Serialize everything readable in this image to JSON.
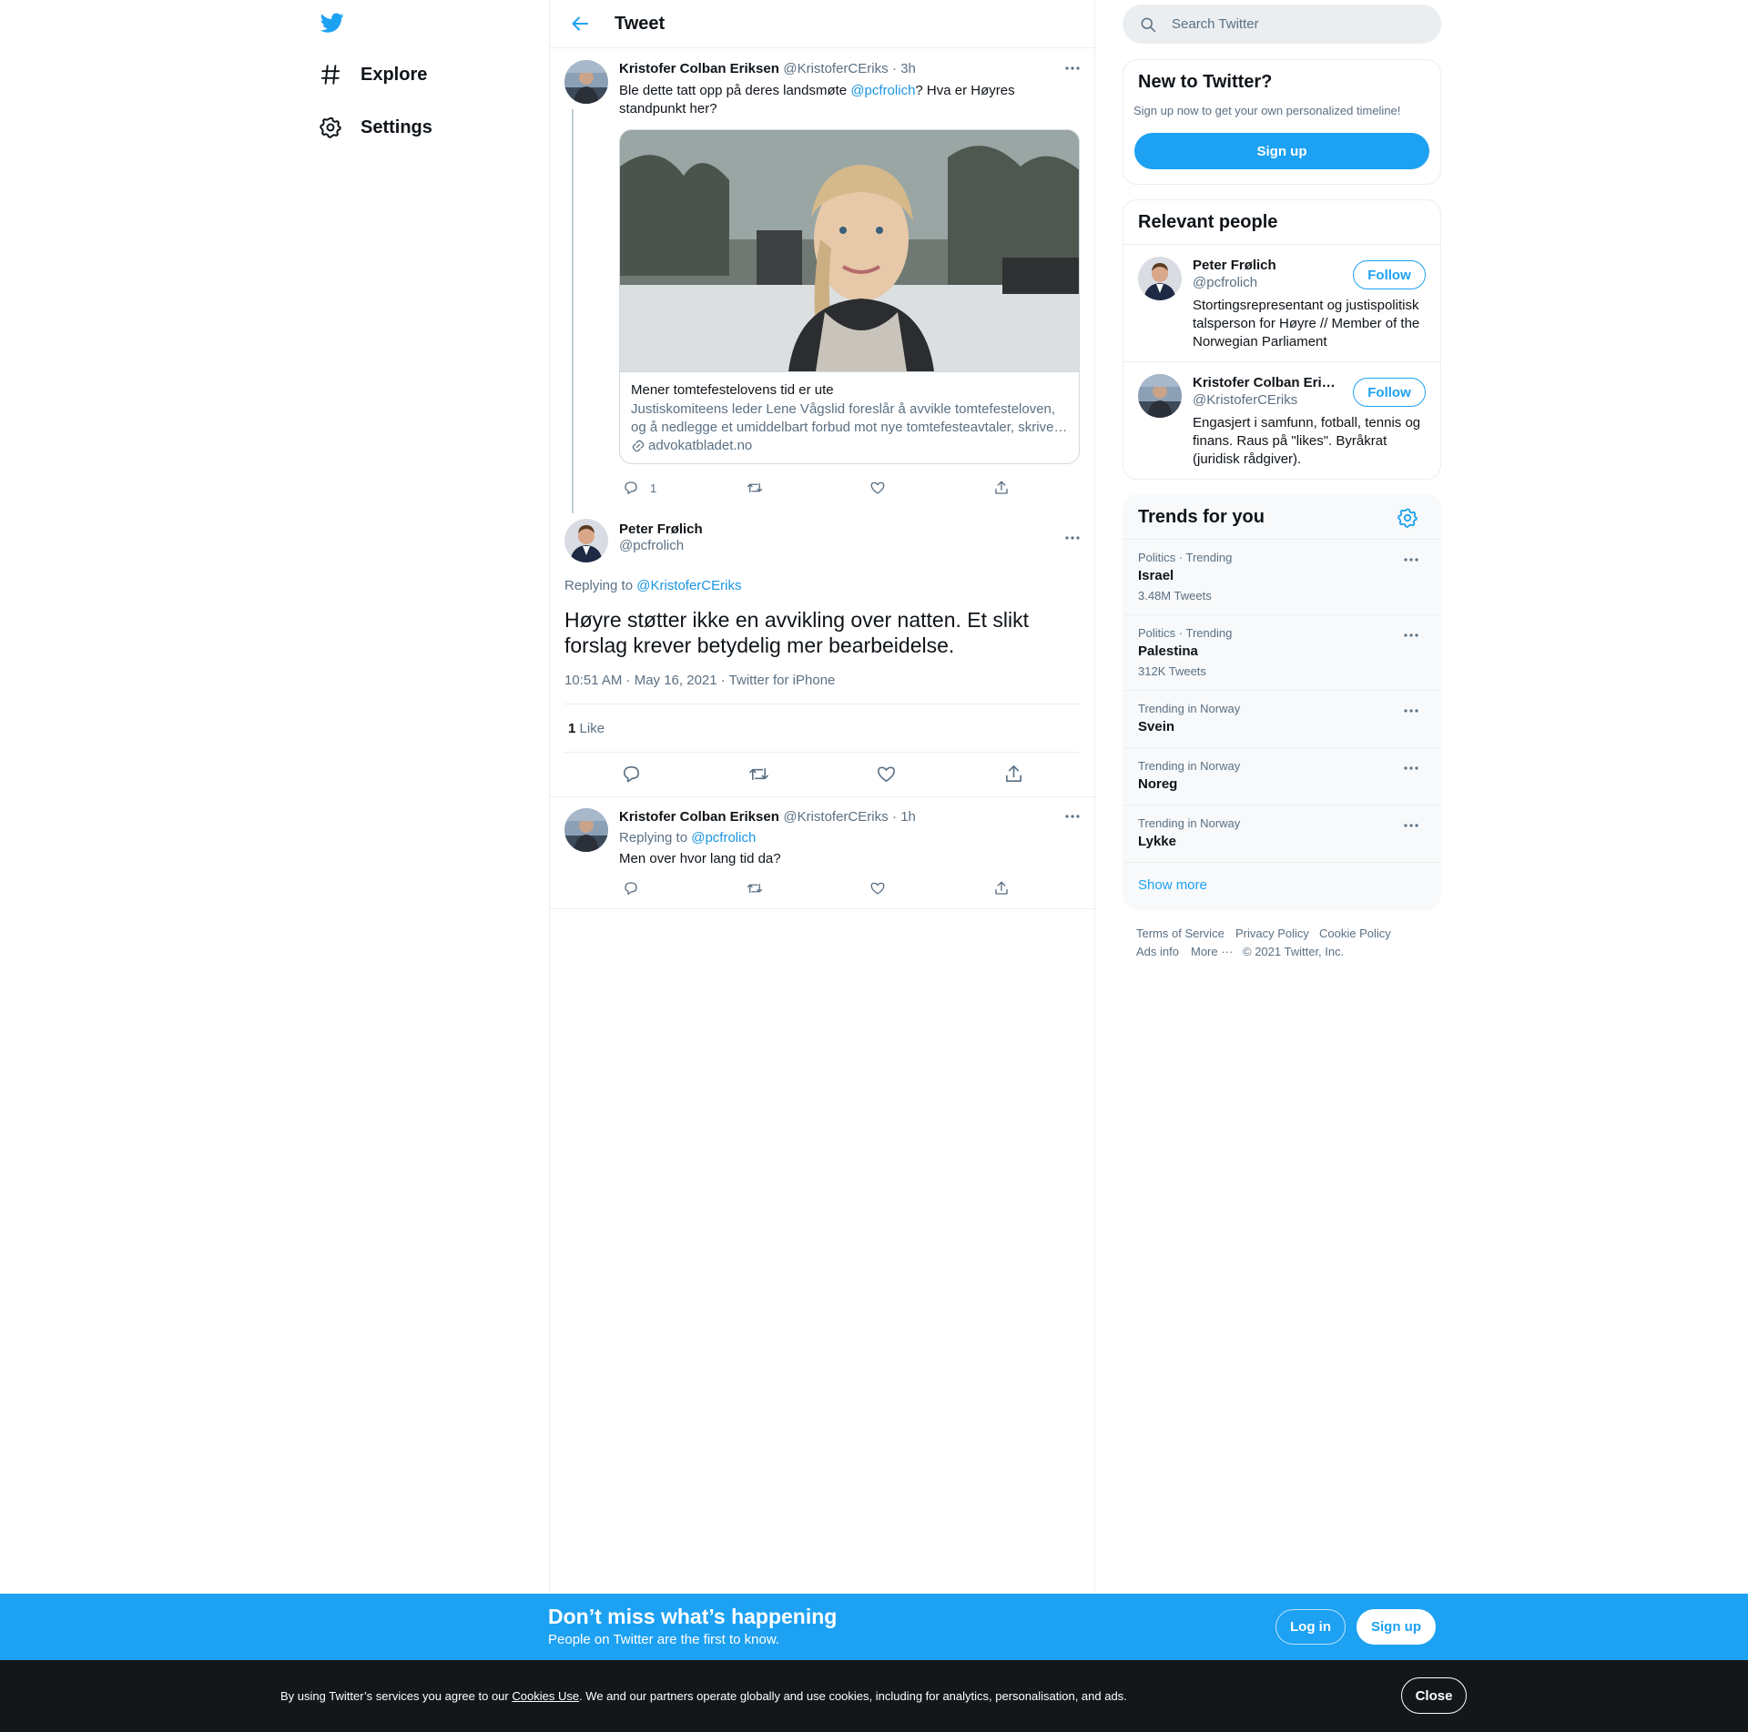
{
  "nav": {
    "explore": "Explore",
    "settings": "Settings"
  },
  "header": {
    "title": "Tweet"
  },
  "tweet1": {
    "name": "Kristofer Colban Eriksen",
    "handle": "@KristoferCEriks",
    "time": "· 3h",
    "text_before": "Ble dette tatt opp på deres landsmøte ",
    "mention": "@pcfrolich",
    "text_after": "? Hva er Høyres standpunkt her?",
    "card": {
      "title": "Mener tomtefestelovens tid er ute",
      "desc": "Justiskomiteens leder Lene Vågslid foreslår å avvikle tomtefesteloven, og å nedlegge et umiddelbart forbud mot nye tomtefesteavtaler, skrive…",
      "domain": "advokatbladet.no"
    },
    "reply_count": "1"
  },
  "main_tweet": {
    "name": "Peter Frølich",
    "handle": "@pcfrolich",
    "replying_label": "Replying to ",
    "replying_to": "@KristoferCEriks",
    "text": "Høyre støtter ikke en avvikling over natten. Et slikt forslag krever betydelig mer bearbeidelse.",
    "meta": "10:51 AM · May 16, 2021 · Twitter for iPhone",
    "likes_count": "1",
    "likes_label": "Like"
  },
  "tweet3": {
    "name": "Kristofer Colban Eriksen",
    "handle": "@KristoferCEriks",
    "time": "· 1h",
    "replying_label": "Replying to ",
    "replying_to": "@pcfrolich",
    "text": "Men over hvor lang tid da?"
  },
  "search": {
    "placeholder": "Search Twitter"
  },
  "new_to_twitter": {
    "title": "New to Twitter?",
    "sub": "Sign up now to get your own personalized timeline!",
    "signup": "Sign up"
  },
  "relevant": {
    "title": "Relevant people",
    "people": [
      {
        "name": "Peter Frølich",
        "handle": "@pcfrolich",
        "bio": "Stortingsrepresentant og justispolitisk talsperson for Høyre // Member of the Norwegian Parliament",
        "follow": "Follow"
      },
      {
        "name": "Kristofer Colban Eri…",
        "handle": "@KristoferCEriks",
        "bio": "Engasjert i samfunn, fotball, tennis og finans. Raus på \"likes\". Byråkrat (juridisk rådgiver).",
        "follow": "Follow"
      }
    ]
  },
  "trends": {
    "title": "Trends for you",
    "items": [
      {
        "meta": "Politics · Trending",
        "name": "Israel",
        "count": "3.48M Tweets"
      },
      {
        "meta": "Politics · Trending",
        "name": "Palestina",
        "count": "312K Tweets"
      },
      {
        "meta": "Trending in Norway",
        "name": "Svein",
        "count": ""
      },
      {
        "meta": "Trending in Norway",
        "name": "Noreg",
        "count": ""
      },
      {
        "meta": "Trending in Norway",
        "name": "Lykke",
        "count": ""
      }
    ],
    "show_more": "Show more"
  },
  "footer": {
    "terms": "Terms of Service",
    "privacy": "Privacy Policy",
    "cookie": "Cookie Policy",
    "ads": "Ads info",
    "more": "More ···",
    "copyright": "© 2021 Twitter, Inc."
  },
  "banner": {
    "title": "Don’t miss what’s happening",
    "sub": "People on Twitter are the first to know.",
    "login": "Log in",
    "signup": "Sign up"
  },
  "cookie": {
    "text_before": "By using Twitter’s services you agree to our ",
    "link": "Cookies Use",
    "text_after": ". We and our partners operate globally and use cookies, including for analytics, personalisation, and ads.",
    "close": "Close"
  },
  "colors": {
    "brand": "#1da1f2",
    "link": "#1b95e0",
    "secondary_text": "#5b7083",
    "border": "#ebeef0"
  }
}
